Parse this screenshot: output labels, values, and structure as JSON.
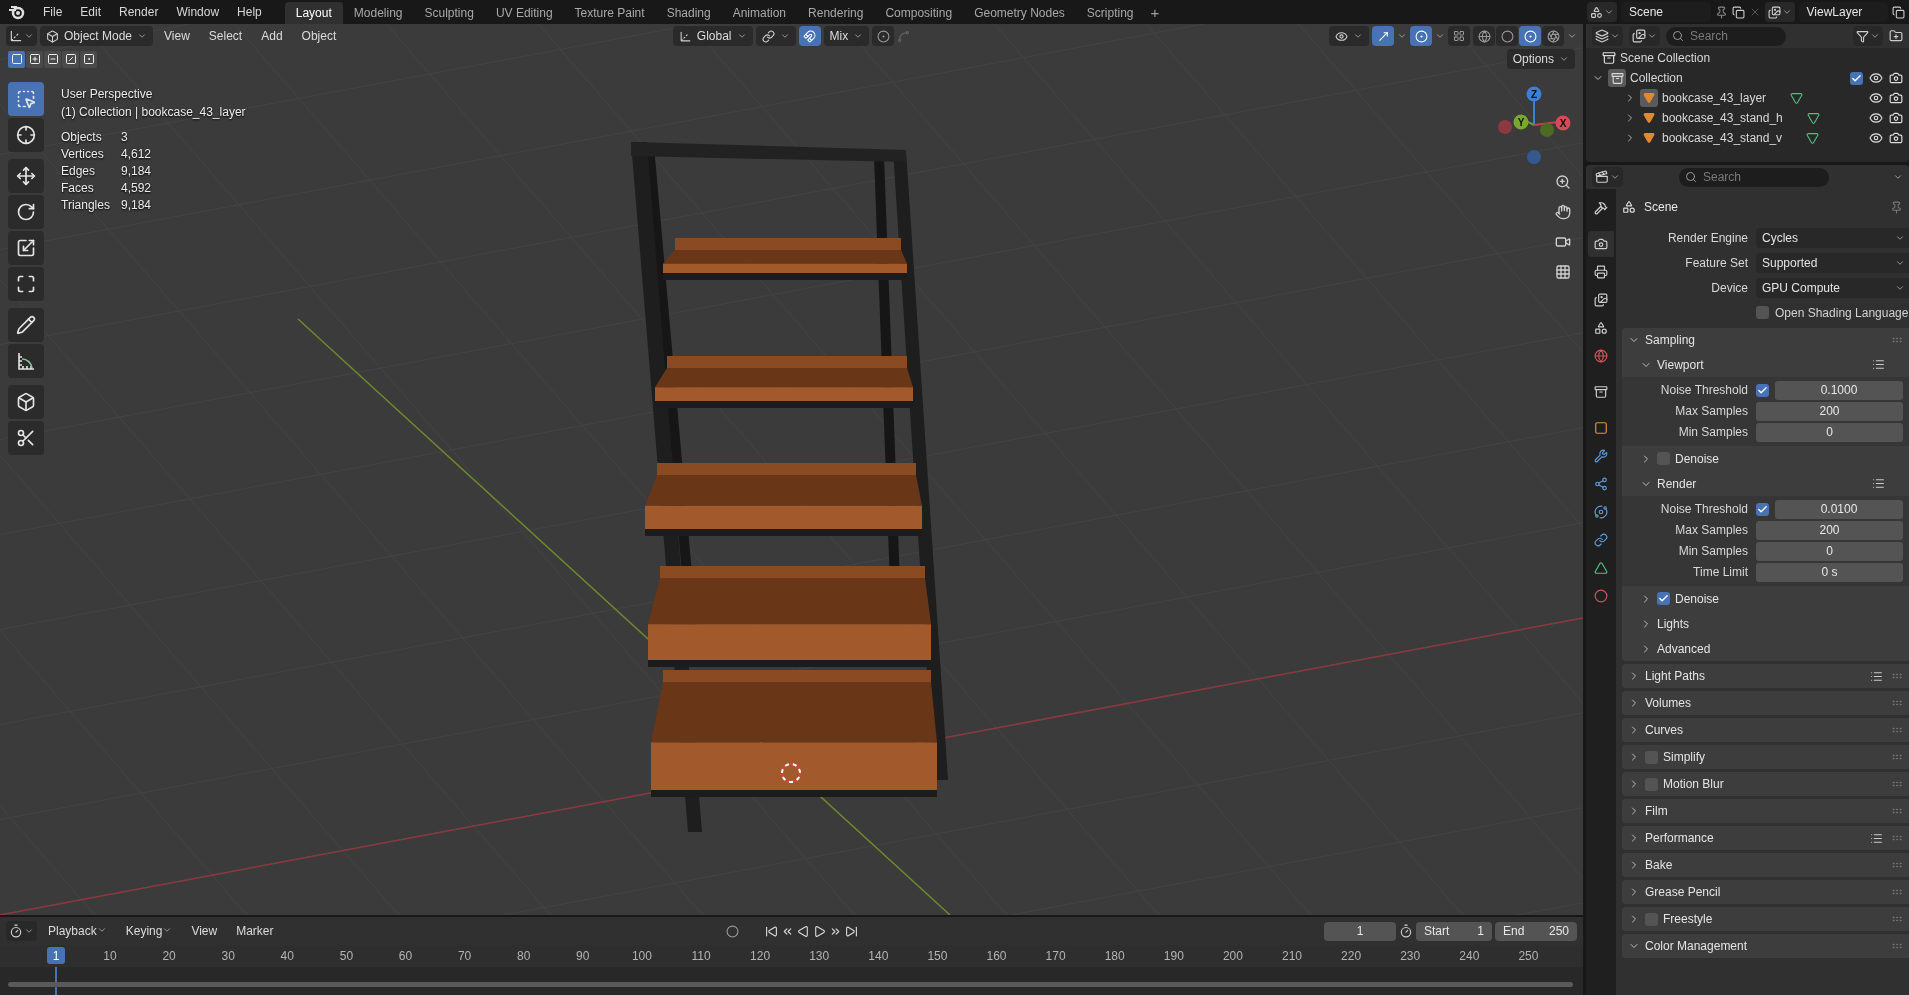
{
  "topbar": {
    "menus": [
      "File",
      "Edit",
      "Render",
      "Window",
      "Help"
    ],
    "workspaces": [
      {
        "label": "Layout",
        "selected": true
      },
      {
        "label": "Modeling",
        "selected": false
      },
      {
        "label": "Sculpting",
        "selected": false
      },
      {
        "label": "UV Editing",
        "selected": false
      },
      {
        "label": "Texture Paint",
        "selected": false
      },
      {
        "label": "Shading",
        "selected": false
      },
      {
        "label": "Animation",
        "selected": false
      },
      {
        "label": "Rendering",
        "selected": false
      },
      {
        "label": "Compositing",
        "selected": false
      },
      {
        "label": "Geometry Nodes",
        "selected": false
      },
      {
        "label": "Scripting",
        "selected": false
      }
    ],
    "add_workspace": "+",
    "scene": "Scene",
    "view_layer": "ViewLayer"
  },
  "viewport": {
    "mode": "Object Mode",
    "menus": [
      "View",
      "Select",
      "Add",
      "Object"
    ],
    "orientation": "Global",
    "snap": true,
    "snap_target": "Mix",
    "proportional": false,
    "gizmos": true,
    "overlays": true,
    "xray": false,
    "shading": [
      {
        "kind": "wireframe",
        "selected": false
      },
      {
        "kind": "solid",
        "selected": false
      },
      {
        "kind": "material",
        "selected": true
      },
      {
        "kind": "rendered",
        "selected": false
      }
    ],
    "options": "Options",
    "select_modes": [
      {
        "kind": "set",
        "selected": true
      },
      {
        "kind": "extend",
        "selected": false
      },
      {
        "kind": "subtract",
        "selected": false
      },
      {
        "kind": "invert",
        "selected": false
      },
      {
        "kind": "intersect",
        "selected": false
      }
    ],
    "tools": [
      {
        "kind": "select-box",
        "selected": true
      },
      {
        "kind": "cursor",
        "selected": false
      },
      {
        "kind": "move",
        "selected": false
      },
      {
        "kind": "rotate",
        "selected": false
      },
      {
        "kind": "scale",
        "selected": false
      },
      {
        "kind": "transform",
        "selected": false
      },
      {
        "kind": "annotate",
        "selected": false
      },
      {
        "kind": "measure",
        "selected": false
      },
      {
        "kind": "add-cube",
        "selected": false
      },
      {
        "kind": "cut",
        "selected": false
      }
    ],
    "info": {
      "view": "User Perspective",
      "context": "(1) Collection | bookcase_43_layer",
      "stats": [
        {
          "label": "Objects",
          "value": "3"
        },
        {
          "label": "Vertices",
          "value": "4,612"
        },
        {
          "label": "Edges",
          "value": "9,184"
        },
        {
          "label": "Faces",
          "value": "4,592"
        },
        {
          "label": "Triangles",
          "value": "9,184"
        }
      ]
    },
    "gizmo": {
      "x": "X",
      "y": "Y",
      "z": "Z"
    }
  },
  "outliner": {
    "search_placeholder": "Search",
    "root": "Scene Collection",
    "collections": [
      {
        "label": "Collection",
        "expanded": true,
        "included": true,
        "objects": [
          {
            "label": "bookcase_43_layer",
            "active": true
          },
          {
            "label": "bookcase_43_stand_h",
            "active": false
          },
          {
            "label": "bookcase_43_stand_v",
            "active": false
          }
        ]
      }
    ]
  },
  "properties": {
    "search_placeholder": "Search",
    "tabs": [
      {
        "kind": "tool",
        "selected": false
      },
      {
        "kind": "render",
        "selected": true
      },
      {
        "kind": "output",
        "selected": false
      },
      {
        "kind": "view-layer",
        "selected": false
      },
      {
        "kind": "scene",
        "selected": false
      },
      {
        "kind": "world",
        "selected": false
      },
      {
        "kind": "collection",
        "selected": false
      },
      {
        "kind": "object",
        "selected": false
      },
      {
        "kind": "modifier",
        "selected": false
      },
      {
        "kind": "particles",
        "selected": false
      },
      {
        "kind": "physics",
        "selected": false
      },
      {
        "kind": "constraints",
        "selected": false
      },
      {
        "kind": "data",
        "selected": false
      },
      {
        "kind": "material",
        "selected": false
      }
    ],
    "context": "Scene",
    "fields": [
      {
        "label": "Render Engine",
        "value": "Cycles"
      },
      {
        "label": "Feature Set",
        "value": "Supported"
      },
      {
        "label": "Device",
        "value": "GPU Compute"
      }
    ],
    "osl": {
      "label": "Open Shading Language",
      "checked": false
    },
    "sampling": {
      "label": "Sampling",
      "expanded": true,
      "subpanels": [
        {
          "label": "Viewport",
          "kind": "plain",
          "expanded": true,
          "presets": true,
          "rows": [
            {
              "kind": "check-number",
              "label": "Noise Threshold",
              "checked": true,
              "value": "0.1000"
            },
            {
              "kind": "number",
              "label": "Max Samples",
              "value": "200"
            },
            {
              "kind": "number",
              "label": "Min Samples",
              "value": "0"
            }
          ]
        },
        {
          "label": "Denoise",
          "kind": "toggle",
          "checked": false,
          "expanded": false
        },
        {
          "label": "Render",
          "kind": "plain",
          "expanded": true,
          "presets": true,
          "rows": [
            {
              "kind": "check-number",
              "label": "Noise Threshold",
              "checked": true,
              "value": "0.0100"
            },
            {
              "kind": "number",
              "label": "Max Samples",
              "value": "200"
            },
            {
              "kind": "number",
              "label": "Min Samples",
              "value": "0"
            },
            {
              "kind": "number",
              "label": "Time Limit",
              "value": "0 s"
            }
          ]
        },
        {
          "label": "Denoise",
          "kind": "toggle",
          "checked": true,
          "expanded": false
        },
        {
          "label": "Lights",
          "kind": "plain",
          "expanded": false
        },
        {
          "label": "Advanced",
          "kind": "plain",
          "expanded": false
        }
      ]
    },
    "panels": [
      {
        "label": "Light Paths",
        "kind": "plain",
        "expanded": false,
        "presets": true
      },
      {
        "label": "Volumes",
        "kind": "plain",
        "expanded": false
      },
      {
        "label": "Curves",
        "kind": "plain",
        "expanded": false
      },
      {
        "label": "Simplify",
        "kind": "toggle",
        "checked": false,
        "expanded": false
      },
      {
        "label": "Motion Blur",
        "kind": "toggle",
        "checked": false,
        "expanded": false
      },
      {
        "label": "Film",
        "kind": "plain",
        "expanded": false
      },
      {
        "label": "Performance",
        "kind": "plain",
        "expanded": false,
        "presets": true
      },
      {
        "label": "Bake",
        "kind": "plain",
        "expanded": false
      },
      {
        "label": "Grease Pencil",
        "kind": "plain",
        "expanded": false
      },
      {
        "label": "Freestyle",
        "kind": "toggle",
        "checked": false,
        "expanded": false
      },
      {
        "label": "Color Management",
        "kind": "plain",
        "expanded": true
      }
    ]
  },
  "timeline": {
    "menus": [
      "Playback",
      "Keying",
      "View",
      "Marker"
    ],
    "current_frame": "1",
    "start_label": "Start",
    "start": "1",
    "end_label": "End",
    "end": "250",
    "playhead": "1",
    "ticks": [
      "10",
      "20",
      "30",
      "40",
      "50",
      "60",
      "70",
      "80",
      "90",
      "100",
      "110",
      "120",
      "130",
      "140",
      "150",
      "160",
      "170",
      "180",
      "190",
      "200",
      "210",
      "220",
      "230",
      "240",
      "250"
    ]
  }
}
